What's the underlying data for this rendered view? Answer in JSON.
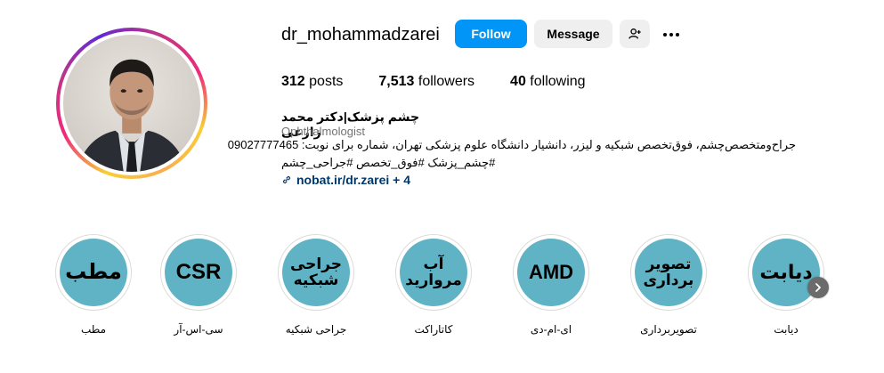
{
  "profile": {
    "username": "dr_mohammadzarei",
    "follow_label": "Follow",
    "message_label": "Message",
    "stats": [
      {
        "value": "312",
        "label": "posts"
      },
      {
        "value": "7,513",
        "label": "followers"
      },
      {
        "value": "40",
        "label": "following"
      }
    ],
    "full_name": "چشم پزشک|دکتر محمد زارعی",
    "category": "Ophthalmologist",
    "bio_line1": "جراح‌ومتخصص‌چشم، فوق‌تخصص شبکیه و لیزر، دانشیار دانشگاه علوم پزشکی تهران، شماره برای نوبت: 09027777465",
    "bio_line2": "#چشم_پزشک #فوق_تخصص #جراحی_چشم",
    "link_text": "nobat.ir/dr.zarei + 4"
  },
  "highlights": [
    {
      "circle_text": "مطب",
      "label": "مطب"
    },
    {
      "circle_text": "CSR",
      "label": "سی-اس-آر"
    },
    {
      "circle_text": "جراحی شبکیه",
      "label": "جراحی شبکیه"
    },
    {
      "circle_text": "آب مروارید",
      "label": "کاتاراکت"
    },
    {
      "circle_text": "AMD",
      "label": "ای-ام-دی"
    },
    {
      "circle_text": "تصویر برداری",
      "label": "تصویربرداری"
    },
    {
      "circle_text": "دیابت",
      "label": "دیابت"
    }
  ],
  "colors": {
    "follow_button": "#0095f6",
    "secondary_button": "#efefef",
    "highlight_fill": "#5fb3c4",
    "link": "#00376b",
    "muted_text": "#737373"
  },
  "icons": {
    "add_person": "person-plus-icon",
    "more": "more-horizontal-icon",
    "link": "link-icon",
    "next": "chevron-right-icon"
  }
}
